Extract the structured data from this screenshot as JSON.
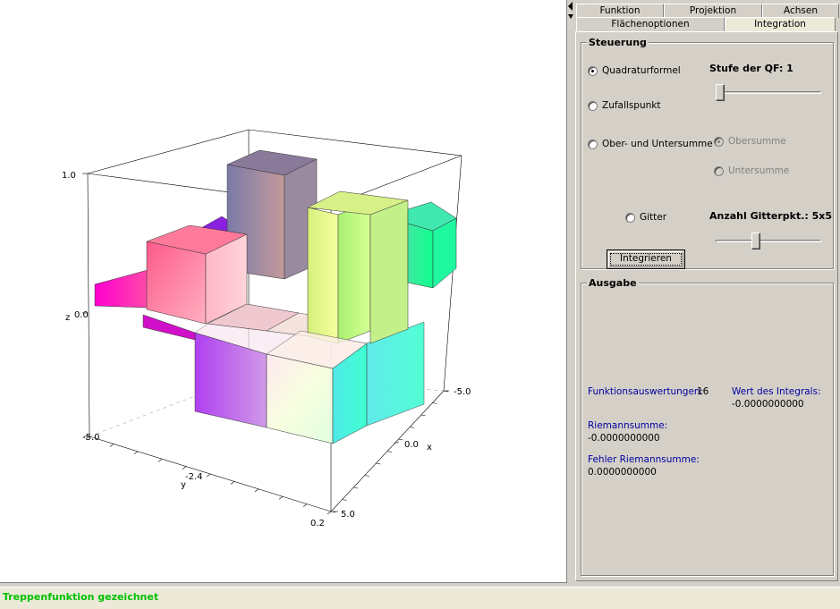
{
  "plot": {
    "axes": {
      "z_ticks": [
        "1.0",
        "0.0",
        "-5.0"
      ],
      "z_label": "z",
      "y_ticks": [
        "-2.4",
        "0.2"
      ],
      "y_label": "y",
      "x_ticks": [
        "-5.0",
        "0.0",
        "5.0"
      ],
      "x_label": "x"
    }
  },
  "tabs": {
    "row1": [
      "Funktion",
      "Projektion",
      "Achsen"
    ],
    "row2": [
      "Flächenoptionen",
      "Integration"
    ],
    "active": "Integration"
  },
  "steuerung": {
    "title": "Steuerung",
    "quadratur_label": "Quadraturformel",
    "zufall_label": "Zufallspunkt",
    "ober_unter_label": "Ober- und Untersumme",
    "obersumme_label": "Obersumme",
    "untersumme_label": "Untersumme",
    "gitter_label": "Gitter",
    "stufe_label": "Stufe der QF: 1",
    "stufe_value": 1,
    "gitter_anzahl_label": "Anzahl Gitterpkt.: 5x5",
    "selected": "Quadraturformel",
    "integrate_button": "Integrieren"
  },
  "ausgabe": {
    "title": "Ausgabe",
    "fa_label": "Funktionsauswertungen:",
    "fa_value": "16",
    "integral_label": "Wert des Integrals:",
    "integral_value": "-0.0000000000",
    "riemann_label": "Riemannsumme:",
    "riemann_value": "-0.0000000000",
    "fehler_label": "Fehler Riemannsumme:",
    "fehler_value": "0.0000000000"
  },
  "status": {
    "text": "Treppenfunktion gezeichnet",
    "color": "#00c000"
  }
}
